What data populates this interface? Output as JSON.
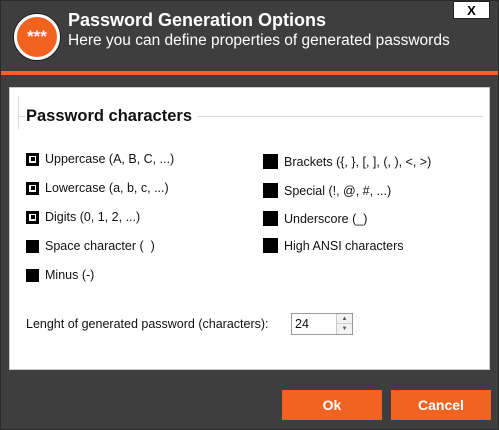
{
  "header": {
    "icon_text": "***",
    "title": "Password Generation Options",
    "subtitle": "Here you can define properties of generated passwords",
    "close_label": "X"
  },
  "section": {
    "title": "Password characters"
  },
  "options_left": [
    {
      "label": "Uppercase (A, B, C, ...)",
      "checked": true
    },
    {
      "label": "Lowercase (a, b, c, ...)",
      "checked": true
    },
    {
      "label": "Digits (0, 1, 2, ...)",
      "checked": true
    },
    {
      "label": "Space character (  )",
      "checked": false
    },
    {
      "label": "Minus (-)",
      "checked": false
    }
  ],
  "options_right": [
    {
      "label": "Brackets ({, }, [, ], (, ), <, >)",
      "checked": false
    },
    {
      "label": "Special (!, @, #, ...)",
      "checked": false
    },
    {
      "label": "Underscore (_)",
      "checked": false
    },
    {
      "label": "High ANSI characters",
      "checked": false
    }
  ],
  "length": {
    "label": "Lenght of generated password (characters):",
    "value": "24"
  },
  "buttons": {
    "ok": "Ok",
    "cancel": "Cancel"
  },
  "colors": {
    "accent": "#f26322",
    "background": "#3e3e3e",
    "panel": "#ffffff"
  }
}
